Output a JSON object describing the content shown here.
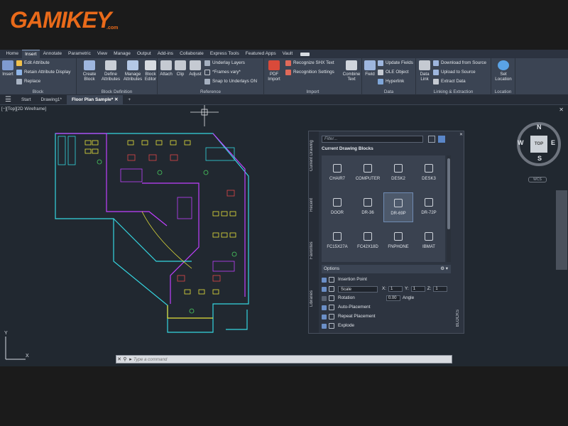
{
  "brand": {
    "name": "GAMIKEY",
    "domain": ".com"
  },
  "tabs": [
    "Home",
    "Insert",
    "Annotate",
    "Parametric",
    "View",
    "Manage",
    "Output",
    "Add-ins",
    "Collaborate",
    "Express Tools",
    "Featured Apps",
    "Vault"
  ],
  "active_tab": "Insert",
  "ribbon": {
    "block": {
      "title": "Block",
      "insert": "Insert",
      "edit_attribute": "Edit Attribute",
      "retain_attribute_display": "Retain Attribute Display",
      "replace": "Replace"
    },
    "block_definition": {
      "title": "Block Definition",
      "create_block": "Create\nBlock",
      "define_attributes": "Define\nAttributes",
      "manage_attributes": "Manage\nAttributes",
      "block_editor": "Block\nEditor"
    },
    "reference": {
      "title": "Reference",
      "attach": "Attach",
      "clip": "Clip",
      "adjust": "Adjust",
      "underlay_layers": "Underlay Layers",
      "frames_vary": "*Frames vary*",
      "snap_to_underlays": "Snap to Underlays ON"
    },
    "import": {
      "title": "Import",
      "pdf_import": "PDF\nImport",
      "recognize_shx_text": "Recognize SHX Text",
      "recognition_settings": "Recognition Settings",
      "combine_text": "Combine\nText"
    },
    "data": {
      "title": "Data",
      "field": "Field",
      "update_fields": "Update Fields",
      "ole_object": "OLE Object",
      "hyperlink": "Hyperlink"
    },
    "linking": {
      "title": "Linking & Extraction",
      "data_link": "Data\nLink",
      "download_from_source": "Download from Source",
      "upload_to_source": "Upload to Source",
      "extract_data": "Extract  Data"
    },
    "location": {
      "title": "Location",
      "set_location": "Set\nLocation"
    }
  },
  "file_tabs": [
    "Start",
    "Drawing1*",
    "Floor Plan Sample*"
  ],
  "view_label": "[−][Top][2D Wireframe]",
  "palette": {
    "filter_placeholder": "Filter...",
    "header": "Current Drawing Blocks",
    "side_tabs": [
      "Current Drawing",
      "Recent",
      "Favorites",
      "Libraries"
    ],
    "blocks": [
      "CHAIR7",
      "COMPUTER",
      "DESK2",
      "DESK3",
      "DOOR",
      "DR-36",
      "DR-69P",
      "DR-72P",
      "FC15X27A",
      "FC42X18D",
      "FNPHONE",
      "IBMAT"
    ],
    "selected_block": "DR-69P",
    "options_title": "Options",
    "options": {
      "insertion_point": "Insertion Point",
      "scale": "Scale",
      "rotation": "Rotation",
      "angle_value": "0.00",
      "angle_label": "Angle",
      "auto_placement": "Auto-Placement",
      "repeat_placement": "Repeat Placement",
      "explode": "Explode",
      "x_label": "X:",
      "x_value": "1",
      "y_label": "Y:",
      "y_value": "1",
      "z_label": "Z:",
      "z_value": "1"
    },
    "title": "BLOCKS"
  },
  "viewcube": {
    "face": "TOP",
    "n": "N",
    "s": "S",
    "e": "E",
    "w": "W",
    "wcs": "WCS"
  },
  "ucs": {
    "x": "X",
    "y": "Y"
  },
  "command": {
    "placeholder": "Type a command"
  },
  "colors": {
    "accent": "#e96a1a",
    "ribbon": "#3b4453",
    "canvas": "#212830",
    "magenta": "#c040ff",
    "cyan": "#35d6e0",
    "yellow": "#e6e23a"
  }
}
